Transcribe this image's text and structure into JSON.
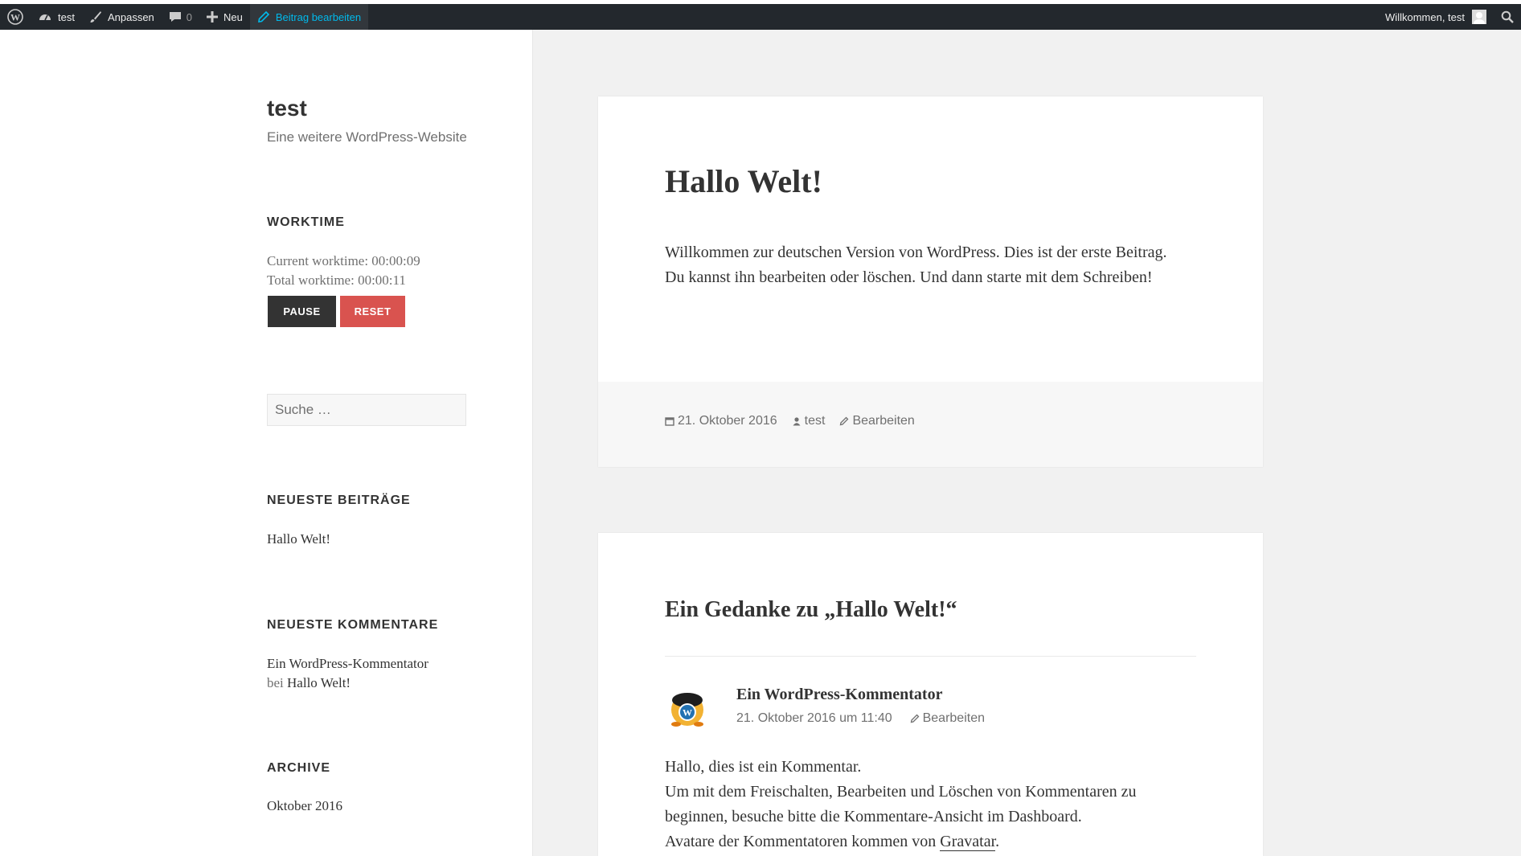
{
  "adminbar": {
    "site": "test",
    "customize": "Anpassen",
    "comments_count": "0",
    "new": "Neu",
    "edit_post": "Beitrag bearbeiten",
    "welcome": "Willkommen, test"
  },
  "sidebar": {
    "site_title": "test",
    "site_description": "Eine weitere WordPress-Website",
    "worktime": {
      "title": "WORKTIME",
      "current": "Current worktime: 00:00:09",
      "total": "Total worktime: 00:00:11",
      "pause_label": "PAUSE",
      "reset_label": "RESET"
    },
    "search_placeholder": "Suche …",
    "recent_posts": {
      "title": "NEUESTE BEITRÄGE",
      "items": [
        "Hallo Welt!"
      ]
    },
    "recent_comments": {
      "title": "NEUESTE KOMMENTARE",
      "author": "Ein WordPress-Kommentator",
      "on": "bei",
      "post": "Hallo Welt!"
    },
    "archive": {
      "title": "ARCHIVE",
      "items": [
        "Oktober 2016"
      ]
    }
  },
  "post": {
    "title": "Hallo Welt!",
    "content": "Willkommen zur deutschen Version von WordPress. Dies ist der erste Beitrag. Du kannst ihn bearbeiten oder löschen. Und dann starte mit dem Schreiben!",
    "date": "21. Oktober 2016",
    "author": "test",
    "edit": "Bearbeiten"
  },
  "comments": {
    "title": "Ein Gedanke zu „Hallo Welt!“",
    "author": "Ein WordPress-Kommentator",
    "date": "21. Oktober 2016 um 11:40",
    "edit": "Bearbeiten",
    "line1": "Hallo, dies ist ein Kommentar.",
    "line2": "Um mit dem Freischalten, Bearbeiten und Löschen von Kommentaren zu beginnen, besuche bitte die Kommentare-Ansicht im Dashboard.",
    "line3_prefix": "Avatare der Kommentatoren kommen von ",
    "line3_link": "Gravatar",
    "line3_suffix": "."
  },
  "colors": {
    "adminbar_bg": "#23282d",
    "adminbar_active": "#00b9eb",
    "pause_bg": "#333333",
    "reset_bg": "#d9534f"
  }
}
